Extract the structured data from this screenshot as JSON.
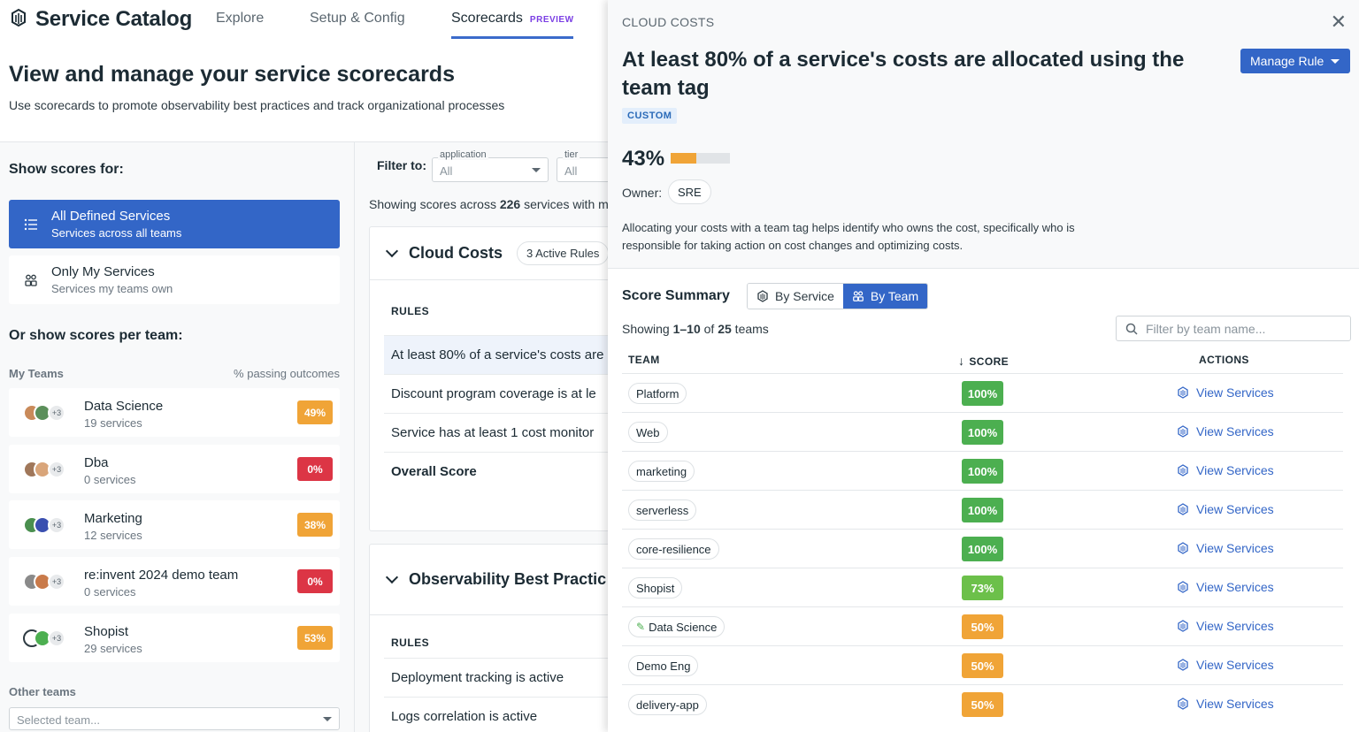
{
  "nav": {
    "app_title": "Service Catalog",
    "tabs": [
      {
        "label": "Explore"
      },
      {
        "label": "Setup & Config"
      },
      {
        "label": "Scorecards",
        "badge": "PREVIEW"
      }
    ]
  },
  "header": {
    "title": "View and manage your service scorecards",
    "subtitle": "Use scorecards to promote observability best practices and track organizational processes"
  },
  "left": {
    "show_scores_for": "Show scores for:",
    "scopes": [
      {
        "title": "All Defined Services",
        "subtitle": "Services across all teams",
        "icon": "list-icon"
      },
      {
        "title": "Only My Services",
        "subtitle": "Services my teams own",
        "icon": "people-icon"
      }
    ],
    "per_team_heading": "Or show scores per team:",
    "my_teams_label": "My Teams",
    "passing_label": "% passing outcomes",
    "teams": [
      {
        "name": "Data Science",
        "count": "19 services",
        "pct": "49%",
        "color": "#f0a437",
        "more": "+3"
      },
      {
        "name": "Dba",
        "count": "0 services",
        "pct": "0%",
        "color": "#dc3545",
        "more": "+3"
      },
      {
        "name": "Marketing",
        "count": "12 services",
        "pct": "38%",
        "color": "#f0a437",
        "more": "+3"
      },
      {
        "name": "re:invent 2024 demo team",
        "count": "0 services",
        "pct": "0%",
        "color": "#dc3545",
        "more": "+3"
      },
      {
        "name": "Shopist",
        "count": "29 services",
        "pct": "53%",
        "color": "#f0a437",
        "more": "+3"
      }
    ],
    "other_teams_label": "Other teams",
    "team_select_placeholder": "Selected team..."
  },
  "middle": {
    "filter_label": "Filter to:",
    "filters": [
      {
        "label": "application",
        "value": "All"
      },
      {
        "label": "tier",
        "value": "All"
      }
    ],
    "showing_prefix": "Showing scores across ",
    "showing_count": "226",
    "showing_suffix": " services with me",
    "scorecards": [
      {
        "title": "Cloud Costs",
        "active_rules": "3 Active Rules",
        "rules_heading": "RULES",
        "rules": [
          "At least 80% of a service's costs are",
          "Discount program coverage is at le",
          "Service has at least 1 cost monitor",
          "Overall Score"
        ]
      },
      {
        "title": "Observability Best Practic",
        "rules_heading": "RULES",
        "rules": [
          "Deployment tracking is active",
          "Logs correlation is active"
        ]
      }
    ]
  },
  "drawer": {
    "eyebrow": "CLOUD COSTS",
    "title": "At least 80% of a service's costs are allocated using the team tag",
    "manage_button": "Manage Rule",
    "badge": "CUSTOM",
    "score_pct": "43%",
    "score_fraction": 0.43,
    "owner_label": "Owner:",
    "owner": "SRE",
    "description": "Allocating your costs with a team tag helps identify who owns the cost, specifically who is responsible for taking action on cost changes and optimizing costs.",
    "score_summary": "Score Summary",
    "toggle": {
      "by_service": "By Service",
      "by_team": "By Team"
    },
    "showing": {
      "prefix": "Showing ",
      "range": "1–10",
      "middle": " of ",
      "total": "25",
      "suffix": " teams"
    },
    "filter_placeholder": "Filter by team name...",
    "columns": {
      "team": "TEAM",
      "score": "SCORE",
      "actions": "ACTIONS"
    },
    "rows": [
      {
        "team": "Platform",
        "score": "100%",
        "color": "#4caf50",
        "action": "View Services"
      },
      {
        "team": "Web",
        "score": "100%",
        "color": "#4caf50",
        "action": "View Services"
      },
      {
        "team": "marketing",
        "score": "100%",
        "color": "#4caf50",
        "action": "View Services"
      },
      {
        "team": "serverless",
        "score": "100%",
        "color": "#4caf50",
        "action": "View Services"
      },
      {
        "team": "core-resilience",
        "score": "100%",
        "color": "#4caf50",
        "action": "View Services"
      },
      {
        "team": "Shopist",
        "score": "73%",
        "color": "#6cc04a",
        "action": "View Services"
      },
      {
        "team": "Data Science",
        "score": "50%",
        "color": "#f0a437",
        "action": "View Services",
        "icon": "pencil-icon"
      },
      {
        "team": "Demo Eng",
        "score": "50%",
        "color": "#f0a437",
        "action": "View Services"
      },
      {
        "team": "delivery-app",
        "score": "50%",
        "color": "#f0a437",
        "action": "View Services"
      }
    ]
  }
}
